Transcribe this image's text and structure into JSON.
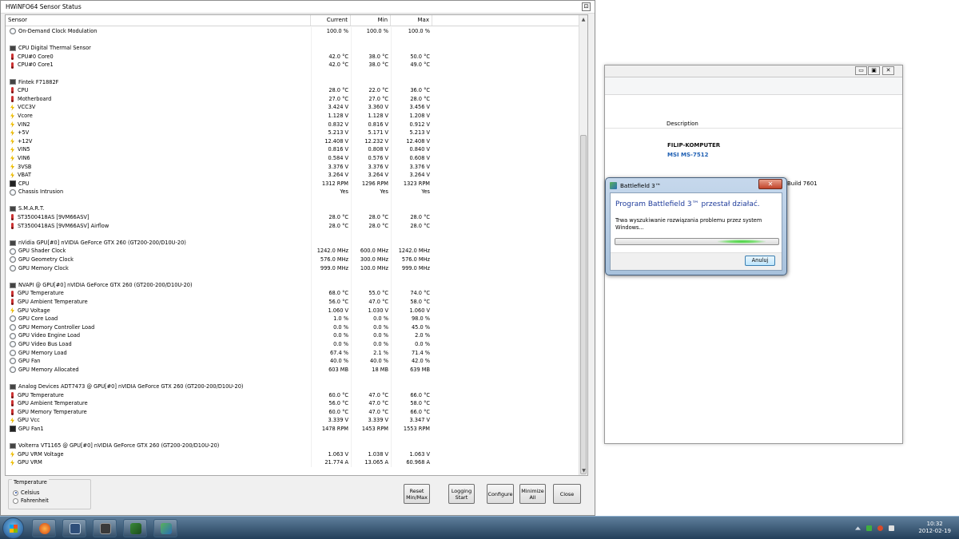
{
  "hwinfo": {
    "title": "HWiNFO64 Sensor Status",
    "columns": [
      "Sensor",
      "Current",
      "Min",
      "Max"
    ],
    "rows": [
      {
        "type": "sensor",
        "icon": "gauge",
        "name": "On-Demand Clock Modulation",
        "cur": "100.0 %",
        "min": "100.0 %",
        "max": "100.0 %"
      },
      {
        "type": "blank"
      },
      {
        "type": "group",
        "icon": "chip",
        "name": "CPU Digital Thermal Sensor"
      },
      {
        "type": "sensor",
        "icon": "therm",
        "name": "CPU#0 Core0",
        "cur": "42.0 °C",
        "min": "38.0 °C",
        "max": "50.0 °C"
      },
      {
        "type": "sensor",
        "icon": "therm",
        "name": "CPU#0 Core1",
        "cur": "42.0 °C",
        "min": "38.0 °C",
        "max": "49.0 °C"
      },
      {
        "type": "blank"
      },
      {
        "type": "group",
        "icon": "chip",
        "name": "Fintek F71882F"
      },
      {
        "type": "sensor",
        "icon": "therm",
        "name": "CPU",
        "cur": "28.0 °C",
        "min": "22.0 °C",
        "max": "36.0 °C"
      },
      {
        "type": "sensor",
        "icon": "therm",
        "name": "Motherboard",
        "cur": "27.0 °C",
        "min": "27.0 °C",
        "max": "28.0 °C"
      },
      {
        "type": "sensor",
        "icon": "volt",
        "name": "VCC3V",
        "cur": "3.424 V",
        "min": "3.360 V",
        "max": "3.456 V"
      },
      {
        "type": "sensor",
        "icon": "volt",
        "name": "Vcore",
        "cur": "1.128 V",
        "min": "1.128 V",
        "max": "1.208 V"
      },
      {
        "type": "sensor",
        "icon": "volt",
        "name": "VIN2",
        "cur": "0.832 V",
        "min": "0.816 V",
        "max": "0.912 V"
      },
      {
        "type": "sensor",
        "icon": "volt",
        "name": "+5V",
        "cur": "5.213 V",
        "min": "5.171 V",
        "max": "5.213 V"
      },
      {
        "type": "sensor",
        "icon": "volt",
        "name": "+12V",
        "cur": "12.408 V",
        "min": "12.232 V",
        "max": "12.408 V"
      },
      {
        "type": "sensor",
        "icon": "volt",
        "name": "VIN5",
        "cur": "0.816 V",
        "min": "0.808 V",
        "max": "0.840 V"
      },
      {
        "type": "sensor",
        "icon": "volt",
        "name": "VIN6",
        "cur": "0.584 V",
        "min": "0.576 V",
        "max": "0.608 V"
      },
      {
        "type": "sensor",
        "icon": "volt",
        "name": "3VSB",
        "cur": "3.376 V",
        "min": "3.376 V",
        "max": "3.376 V"
      },
      {
        "type": "sensor",
        "icon": "volt",
        "name": "VBAT",
        "cur": "3.264 V",
        "min": "3.264 V",
        "max": "3.264 V"
      },
      {
        "type": "sensor",
        "icon": "fan",
        "name": "CPU",
        "cur": "1312 RPM",
        "min": "1296 RPM",
        "max": "1323 RPM"
      },
      {
        "type": "sensor",
        "icon": "gauge",
        "name": "Chassis Intrusion",
        "cur": "Yes",
        "min": "Yes",
        "max": "Yes"
      },
      {
        "type": "blank"
      },
      {
        "type": "group",
        "icon": "chip",
        "name": "S.M.A.R.T."
      },
      {
        "type": "sensor",
        "icon": "therm",
        "name": "ST3500418AS [9VM66ASV]",
        "cur": "28.0 °C",
        "min": "28.0 °C",
        "max": "28.0 °C"
      },
      {
        "type": "sensor",
        "icon": "therm",
        "name": "ST3500418AS [9VM66ASV] Airflow",
        "cur": "28.0 °C",
        "min": "28.0 °C",
        "max": "28.0 °C"
      },
      {
        "type": "blank"
      },
      {
        "type": "group",
        "icon": "chip",
        "name": "nVidia GPU[#0] nVIDIA GeForce GTX 260 (GT200-200/D10U-20)"
      },
      {
        "type": "sensor",
        "icon": "gauge",
        "name": "GPU Shader Clock",
        "cur": "1242.0 MHz",
        "min": "600.0 MHz",
        "max": "1242.0 MHz"
      },
      {
        "type": "sensor",
        "icon": "gauge",
        "name": "GPU Geometry Clock",
        "cur": "576.0 MHz",
        "min": "300.0 MHz",
        "max": "576.0 MHz"
      },
      {
        "type": "sensor",
        "icon": "gauge",
        "name": "GPU Memory Clock",
        "cur": "999.0 MHz",
        "min": "100.0 MHz",
        "max": "999.0 MHz"
      },
      {
        "type": "blank"
      },
      {
        "type": "group",
        "icon": "chip",
        "name": "NVAPI @ GPU[#0] nVIDIA GeForce GTX 260 (GT200-200/D10U-20)"
      },
      {
        "type": "sensor",
        "icon": "therm",
        "name": "GPU Temperature",
        "cur": "68.0 °C",
        "min": "55.0 °C",
        "max": "74.0 °C"
      },
      {
        "type": "sensor",
        "icon": "therm",
        "name": "GPU Ambient Temperature",
        "cur": "56.0 °C",
        "min": "47.0 °C",
        "max": "58.0 °C"
      },
      {
        "type": "sensor",
        "icon": "volt",
        "name": "GPU Voltage",
        "cur": "1.060 V",
        "min": "1.030 V",
        "max": "1.060 V"
      },
      {
        "type": "sensor",
        "icon": "gauge",
        "name": "GPU Core Load",
        "cur": "1.0 %",
        "min": "0.0 %",
        "max": "98.0 %"
      },
      {
        "type": "sensor",
        "icon": "gauge",
        "name": "GPU Memory Controller Load",
        "cur": "0.0 %",
        "min": "0.0 %",
        "max": "45.0 %"
      },
      {
        "type": "sensor",
        "icon": "gauge",
        "name": "GPU Video Engine Load",
        "cur": "0.0 %",
        "min": "0.0 %",
        "max": "2.0 %"
      },
      {
        "type": "sensor",
        "icon": "gauge",
        "name": "GPU Video Bus Load",
        "cur": "0.0 %",
        "min": "0.0 %",
        "max": "0.0 %"
      },
      {
        "type": "sensor",
        "icon": "gauge",
        "name": "GPU Memory Load",
        "cur": "67.4 %",
        "min": "2.1 %",
        "max": "71.4 %"
      },
      {
        "type": "sensor",
        "icon": "gauge",
        "name": "GPU Fan",
        "cur": "40.0 %",
        "min": "40.0 %",
        "max": "42.0 %"
      },
      {
        "type": "sensor",
        "icon": "gauge",
        "name": "GPU Memory Allocated",
        "cur": "603 MB",
        "min": "18 MB",
        "max": "639 MB"
      },
      {
        "type": "blank"
      },
      {
        "type": "group",
        "icon": "chip",
        "name": "Analog Devices ADT7473 @ GPU[#0] nVIDIA GeForce GTX 260 (GT200-200/D10U-20)"
      },
      {
        "type": "sensor",
        "icon": "therm",
        "name": "GPU Temperature",
        "cur": "60.0 °C",
        "min": "47.0 °C",
        "max": "66.0 °C"
      },
      {
        "type": "sensor",
        "icon": "therm",
        "name": "GPU Ambient Temperature",
        "cur": "56.0 °C",
        "min": "47.0 °C",
        "max": "58.0 °C"
      },
      {
        "type": "sensor",
        "icon": "therm",
        "name": "GPU Memory Temperature",
        "cur": "60.0 °C",
        "min": "47.0 °C",
        "max": "66.0 °C"
      },
      {
        "type": "sensor",
        "icon": "volt",
        "name": "GPU Vcc",
        "cur": "3.339 V",
        "min": "3.339 V",
        "max": "3.347 V"
      },
      {
        "type": "sensor",
        "icon": "fan",
        "name": "GPU Fan1",
        "cur": "1478 RPM",
        "min": "1453 RPM",
        "max": "1553 RPM"
      },
      {
        "type": "blank"
      },
      {
        "type": "group",
        "icon": "chip",
        "name": "Volterra VT1165 @ GPU[#0] nVIDIA GeForce GTX 260 (GT200-200/D10U-20)"
      },
      {
        "type": "sensor",
        "icon": "volt",
        "name": "GPU VRM Voltage",
        "cur": "1.063 V",
        "min": "1.038 V",
        "max": "1.063 V"
      },
      {
        "type": "sensor",
        "icon": "volt",
        "name": "GPU VRM",
        "cur": "21.774 A",
        "min": "13.065 A",
        "max": "60.968 A"
      }
    ],
    "temperature": {
      "legend": "Temperature",
      "celsius": "Celsius",
      "fahrenheit": "Fahrenheit",
      "selected": "Celsius"
    },
    "buttons": {
      "reset": "Reset\nMin/Max",
      "logging": "Logging\nStart",
      "configure": "Configure",
      "minimize": "Minimize\nAll",
      "close": "Close"
    }
  },
  "sysinfo": {
    "column_header": "Description",
    "computer_name": "FILIP-KOMPUTER",
    "model": "MSI MS-7512",
    "build": "Build 7601"
  },
  "dialog": {
    "title": "Battlefield 3™",
    "heading": "Program Battlefield 3™ przestał działać.",
    "message": "Trwa wyszukiwanie rozwiązania problemu przez system Windows...",
    "button": "Anuluj",
    "close_glyph": "✕"
  },
  "taskbar": {
    "time": "10:32",
    "date": "2012-02-19"
  }
}
